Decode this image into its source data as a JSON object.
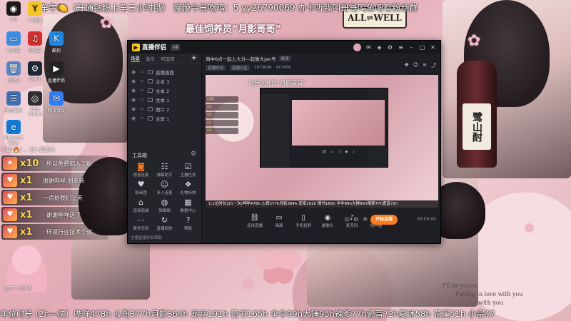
{
  "marquee_top": "车牛🍋（开通钻粉上车三小时哦） 慢慢今日吃鸡：5 yy26790069 办卡听我叫哥哥鸣鱼吧有粉丝群",
  "stream_title": "最佳饲养员“月影哥哥”",
  "sticker_allwell": "ALL⇌WELL",
  "bottle_label": "鹭山酎",
  "bottom_ticker": "年位时长 (2h—次）哔咩478h 心哥377h月影364h 宠幸191h 情书165h 伞伞99h大锤95h辣爹77h瓷音72h夏沐58h 花溪51h 小宗47",
  "bear_label": "107.0008",
  "lace_text": [
    "I'll be yours",
    "Falling in love with you",
    "with you"
  ],
  "desktop": {
    "icons": [
      {
        "label": "QQ",
        "icon": "penguin-icon",
        "color": "#1a1a1a"
      },
      {
        "label": "YY直播",
        "icon": "yy-icon",
        "color": "#f3c623"
      },
      {
        "label": "此电脑",
        "icon": "computer-icon",
        "color": "#3a8ee6"
      },
      {
        "label": "网易云",
        "icon": "music-icon",
        "color": "#d32f2f"
      },
      {
        "label": "回收站",
        "icon": "trash-icon",
        "color": "#5a88c8"
      },
      {
        "label": "酷狗",
        "icon": "kugou-icon",
        "color": "#1e88e5"
      },
      {
        "label": "控制面板",
        "icon": "control-panel-icon",
        "color": "#3f6fb5"
      },
      {
        "label": "steam",
        "icon": "steam-icon",
        "color": "#1b2838"
      },
      {
        "label": "直播伴侣",
        "icon": "live-companion-icon",
        "color": "#222"
      },
      {
        "label": "Microsoft Edge",
        "icon": "edge-icon",
        "color": "#0a7bd8"
      },
      {
        "label": "OBS Studio",
        "icon": "obs-icon",
        "color": "#302e31"
      },
      {
        "label": "腾讯会议",
        "icon": "meeting-icon",
        "color": "#2f7df6"
      }
    ]
  },
  "chat_overlay": {
    "top_line": "欢迎[🔥] ... 进入直播间",
    "rows": [
      {
        "count": "x10",
        "text": "· 所以免费加入了粉"
      },
      {
        "count": "x1",
        "text": "谢谢哔咩·朋友新"
      },
      {
        "count": "x1",
        "text": "一点给我们上天"
      },
      {
        "count": "x1",
        "text": "· 谢谢哔咩送了"
      },
      {
        "count": "x1",
        "text": "· 环境行业技术个派"
      }
    ]
  },
  "app": {
    "logo_text": "直播伴侣",
    "version_badge": "v9",
    "side_tabs": [
      "场景",
      "音乐",
      "可选项"
    ],
    "scene_items": [
      "直播画面",
      "文本 3",
      "文本 2",
      "文本 1",
      "图片 2",
      "全屏 1"
    ],
    "tools_label": "工具箱",
    "tools": [
      {
        "label": "语音连麦",
        "icon": "mic-call-icon"
      },
      {
        "label": "弹幕助手",
        "icon": "danmaku-icon"
      },
      {
        "label": "主播任务",
        "icon": "task-icon"
      },
      {
        "label": "粉丝团",
        "icon": "fans-icon"
      },
      {
        "label": "多人连麦",
        "icon": "multi-mic-icon"
      },
      {
        "label": "礼物特效",
        "icon": "gift-icon"
      },
      {
        "label": "道具商城",
        "icon": "shop-icon"
      },
      {
        "label": "弹幕姬",
        "icon": "bubble-icon"
      },
      {
        "label": "数据中心",
        "icon": "data-icon"
      },
      {
        "label": "更多应用",
        "icon": "more-icon"
      },
      {
        "label": "直播回放",
        "icon": "replay-icon"
      },
      {
        "label": "帮助",
        "icon": "help-icon"
      }
    ],
    "sidebar_footer": "主播直播伴侣帮助",
    "room_title": "周中6点一起上大分—起做大Jan号",
    "room_edit_label": "修改",
    "room_meta": [
      "直播时间",
      "直播分区",
      "1879006",
      "417458"
    ],
    "preview_title": "最佳饲养员“月影哥哥”",
    "preview_strip": "1:1位时长(2h一次)哔咩478h 心哥377h月影364h 宠幸191h 情书165h 伞伞99h大锤95h辣爹77h瓷音72h",
    "toolbar": [
      {
        "label": "连线直播",
        "icon": "link-icon"
      },
      {
        "label": "画面",
        "icon": "screen-icon"
      },
      {
        "label": "手机投屏",
        "icon": "phone-cast-icon"
      },
      {
        "label": "摄像头",
        "icon": "camera-icon"
      },
      {
        "label": "麦克风",
        "icon": "microphone-icon"
      },
      {
        "label": "扬声器",
        "icon": "speaker-icon"
      }
    ],
    "live_button": "开始直播",
    "time_readout": "00:00:00"
  }
}
